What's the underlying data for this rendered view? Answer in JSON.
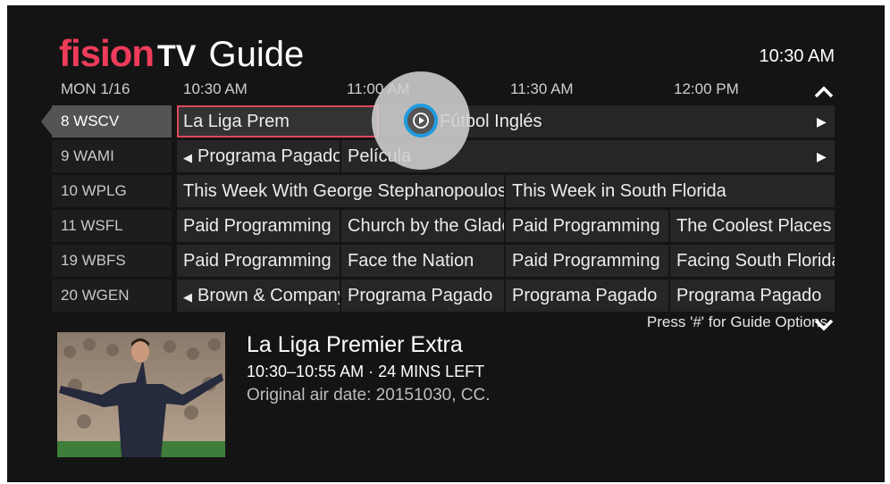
{
  "brand": {
    "name": "fision",
    "tv": "TV",
    "title": "Guide"
  },
  "clock": "10:30 AM",
  "header": {
    "date": "MON 1/16",
    "times": [
      "10:30 AM",
      "11:00 AM",
      "11:30 AM",
      "12:00 PM"
    ]
  },
  "channels": [
    "8 WSCV",
    "9 WAMI",
    "10 WPLG",
    "11 WSFL",
    "19 WBFS",
    "20 WGEN"
  ],
  "grid": {
    "r0": [
      "La Liga Prem",
      "Fútbol Inglés"
    ],
    "r1": [
      "Programa Pagado",
      "Película"
    ],
    "r2": [
      "This Week With George Stephanopoulos",
      "This Week in South Florida"
    ],
    "r3": [
      "Paid Programming",
      "Church by the Glades",
      "Paid Programming",
      "The Coolest Places"
    ],
    "r4": [
      "Paid Programming",
      "Face the Nation",
      "Paid Programming",
      "Facing South Florida"
    ],
    "r5": [
      "Brown & Company",
      "Programa Pagado",
      "Programa Pagado",
      "Programa Pagado"
    ]
  },
  "options_hint": "Press '#' for Guide Options",
  "details": {
    "title": "La Liga Premier Extra",
    "time": "10:30–10:55 AM · 24 MINS LEFT",
    "airdate": "Original air date: 20151030, CC."
  },
  "colors": {
    "brand": "#ee3c5a",
    "focus_ring": "#1f9be0",
    "selected_border": "#e0475a"
  }
}
